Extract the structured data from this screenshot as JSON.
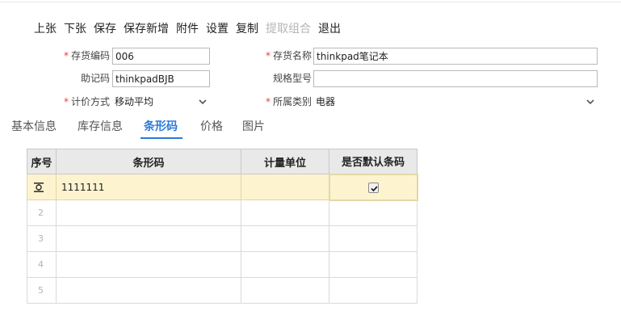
{
  "toolbar": {
    "prev": "上张",
    "next": "下张",
    "save": "保存",
    "save_new": "保存新增",
    "attach": "附件",
    "settings": "设置",
    "copy": "复制",
    "extract": "提取组合",
    "exit": "退出"
  },
  "form": {
    "code_label": "存货编码",
    "code_value": "006",
    "name_label": "存货名称",
    "name_value": "thinkpad笔记本",
    "mnemonic_label": "助记码",
    "mnemonic_value": "thinkpadBJB",
    "spec_label": "规格型号",
    "spec_value": "",
    "pricing_label": "计价方式",
    "pricing_value": "移动平均",
    "category_label": "所属类别",
    "category_value": "电器"
  },
  "tabs": [
    "基本信息",
    "库存信息",
    "条形码",
    "价格",
    "图片"
  ],
  "grid": {
    "columns": [
      "序号",
      "条形码",
      "计量单位",
      "是否默认条码"
    ],
    "rows": [
      {
        "no": "",
        "barcode": "1111111",
        "unit": "",
        "default": true
      },
      {
        "no": "2",
        "barcode": "",
        "unit": ""
      },
      {
        "no": "3",
        "barcode": "",
        "unit": ""
      },
      {
        "no": "4",
        "barcode": "",
        "unit": ""
      },
      {
        "no": "5",
        "barcode": "",
        "unit": ""
      }
    ]
  },
  "colors": {
    "accent": "#2a7ad8",
    "required": "#e0433c",
    "selected_row": "#fdf3cf"
  }
}
